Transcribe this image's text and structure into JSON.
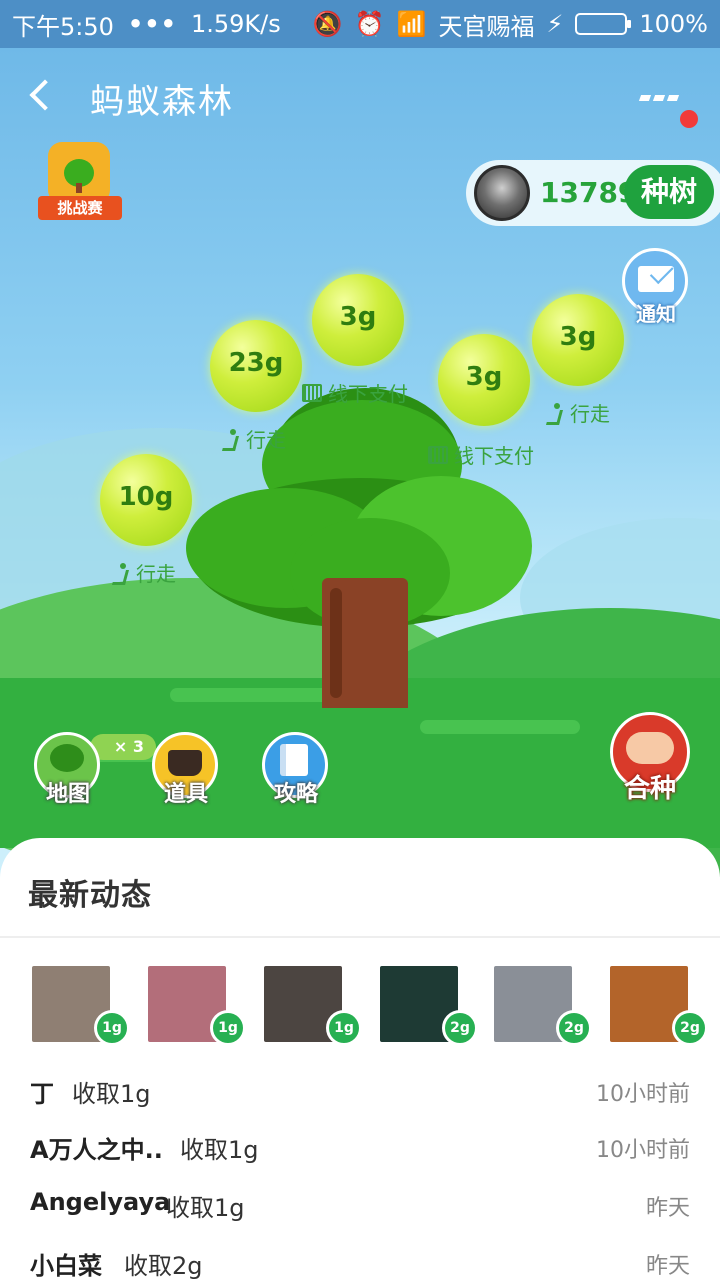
{
  "status_bar": {
    "time": "下午5:50",
    "dots": "•••",
    "speed": "1.59K/s",
    "carrier": "天官赐福",
    "battery": "100%",
    "battery_level": 1.0
  },
  "header": {
    "title": "蚂蚁森林"
  },
  "challenge": {
    "label": "挑战赛"
  },
  "energy": {
    "amount": "13789g",
    "plant_label": "种树"
  },
  "notice": {
    "label": "通知"
  },
  "bubbles": [
    {
      "value": "23g",
      "tag": "行走",
      "tag_icon": "walk-icon"
    },
    {
      "value": "3g",
      "tag": "线下支付",
      "tag_icon": "barcode-icon"
    },
    {
      "value": "3g",
      "tag": "线下支付",
      "tag_icon": "barcode-icon"
    },
    {
      "value": "3g",
      "tag": "行走",
      "tag_icon": "walk-icon"
    },
    {
      "value": "10g",
      "tag": "行走",
      "tag_icon": "walk-icon"
    }
  ],
  "tools": {
    "map": {
      "label": "地图",
      "badge": "× 3"
    },
    "props": {
      "label": "道具"
    },
    "guide": {
      "label": "攻略"
    },
    "cojoin": {
      "label": "合种"
    }
  },
  "feed": {
    "title": "最新动态",
    "thumbs": [
      {
        "amount": "1g",
        "color": "#8f7f73"
      },
      {
        "amount": "1g",
        "color": "#b36e7a"
      },
      {
        "amount": "1g",
        "color": "#4c4541"
      },
      {
        "amount": "2g",
        "color": "#1e3a34"
      },
      {
        "amount": "2g",
        "color": "#8a8f97"
      },
      {
        "amount": "2g",
        "color": "#b3642a"
      }
    ],
    "rows": [
      {
        "name": "丁",
        "action": "收取1g",
        "time": "10小时前"
      },
      {
        "name": "A万人之中..",
        "action": "收取1g",
        "time": "10小时前"
      },
      {
        "name": "Angelyaya",
        "action": "收取1g",
        "time": "昨天"
      },
      {
        "name": "小白菜",
        "action": "收取2g",
        "time": "昨天"
      }
    ]
  },
  "colors": {
    "status_bar": "#4d8fc6",
    "accent_green": "#1fa23e",
    "bubble": "#cfee3c",
    "tag_green": "#3aa33f"
  }
}
